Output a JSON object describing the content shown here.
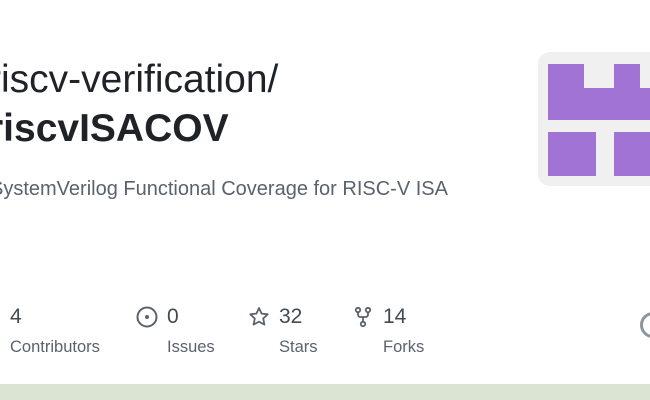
{
  "repo": {
    "owner_line": "riscv-verification/",
    "name": "riscvISACOV",
    "description": "SystemVerilog Functional Coverage for RISC-V ISA"
  },
  "colors": {
    "avatar_bg": "#f0f0f0",
    "avatar_accent": "#a073d4",
    "bottom_bar": "#dbe3d2"
  },
  "stats": {
    "contributors": {
      "value": "4",
      "label": "Contributors",
      "icon": "people-icon"
    },
    "issues": {
      "value": "0",
      "label": "Issues",
      "icon": "issue-circle-icon"
    },
    "stars": {
      "value": "32",
      "label": "Stars",
      "icon": "star-icon"
    },
    "forks": {
      "value": "14",
      "label": "Forks",
      "icon": "fork-icon"
    }
  }
}
